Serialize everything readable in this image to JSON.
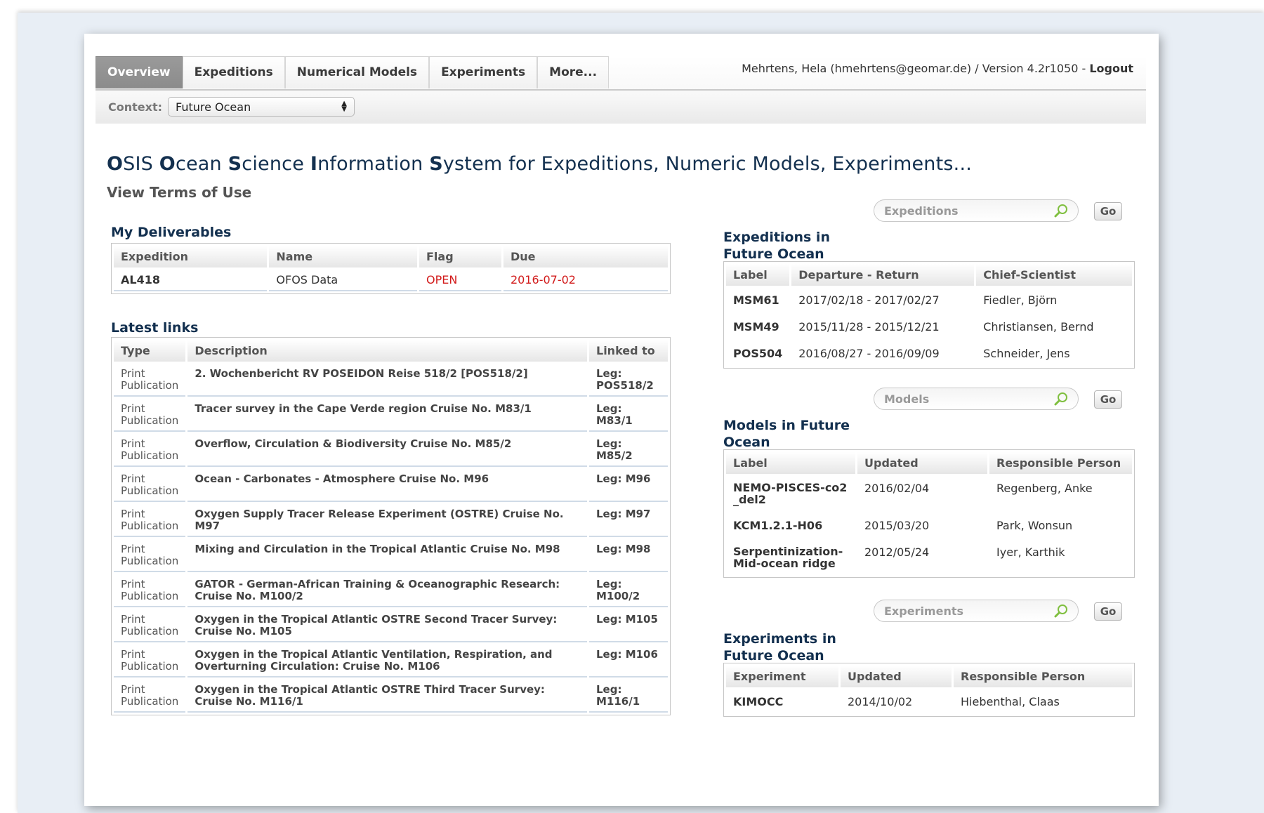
{
  "nav": {
    "tabs": [
      "Overview",
      "Expeditions",
      "Numerical Models",
      "Experiments",
      "More..."
    ],
    "active_tab": "Overview",
    "user": "Mehrtens, Hela (hmehrtens@geomar.de) / Version 4.2r1050 - ",
    "logout": "Logout",
    "context_label": "Context:",
    "context_value": "Future Ocean"
  },
  "title": {
    "parts": [
      "O",
      "SIS ",
      "O",
      "cean ",
      "S",
      "cience ",
      "I",
      "nformation ",
      "S",
      "ystem for Expeditions, Numeric Models, Experiments..."
    ],
    "terms": "View Terms of Use"
  },
  "deliverables": {
    "heading": "My Deliverables",
    "columns": [
      "Expedition",
      "Name",
      "Flag",
      "Due"
    ],
    "rows": [
      {
        "expedition": "AL418",
        "name": "OFOS Data",
        "flag": "OPEN",
        "due": "2016-07-02"
      }
    ]
  },
  "links": {
    "heading": "Latest links",
    "columns": [
      "Type",
      "Description",
      "Linked to"
    ],
    "rows": [
      {
        "type": "Print Publication",
        "desc": "2. Wochenbericht RV POSEIDON Reise 518/2 [POS518/2]",
        "leg": "Leg: POS518/2"
      },
      {
        "type": "Print Publication",
        "desc": "Tracer survey in the Cape Verde region Cruise No. M83/1",
        "leg": "Leg: M83/1"
      },
      {
        "type": "Print Publication",
        "desc": "Overflow, Circulation & Biodiversity Cruise No. M85/2",
        "leg": "Leg: M85/2"
      },
      {
        "type": "Print Publication",
        "desc": "Ocean - Carbonates - Atmosphere Cruise No. M96",
        "leg": "Leg: M96"
      },
      {
        "type": "Print Publication",
        "desc": "Oxygen Supply Tracer Release Experiment (OSTRE) Cruise No. M97",
        "leg": "Leg: M97"
      },
      {
        "type": "Print Publication",
        "desc": "Mixing and Circulation in the Tropical Atlantic Cruise No. M98",
        "leg": "Leg: M98"
      },
      {
        "type": "Print Publication",
        "desc": "GATOR - German-African Training & Oceanographic Research: Cruise No. M100/2",
        "leg": "Leg: M100/2"
      },
      {
        "type": "Print Publication",
        "desc": "Oxygen in the Tropical Atlantic OSTRE Second Tracer Survey: Cruise No. M105",
        "leg": "Leg: M105"
      },
      {
        "type": "Print Publication",
        "desc": "Oxygen in the Tropical Atlantic Ventilation, Respiration, and Overturning Circulation: Cruise No. M106",
        "leg": "Leg: M106"
      },
      {
        "type": "Print Publication",
        "desc": "Oxygen in the Tropical Atlantic OSTRE Third Tracer Survey: Cruise No. M116/1",
        "leg": "Leg: M116/1"
      }
    ]
  },
  "expeditions": {
    "search_placeholder": "Expeditions",
    "go": "Go",
    "heading": "Expeditions in Future Ocean",
    "columns": [
      "Label",
      "Departure - Return",
      "Chief-Scientist"
    ],
    "rows": [
      {
        "label": "MSM61",
        "dates": "2017/02/18 - 2017/02/27",
        "person": "Fiedler, Björn"
      },
      {
        "label": "MSM49",
        "dates": "2015/11/28 - 2015/12/21",
        "person": "Christiansen, Bernd"
      },
      {
        "label": "POS504",
        "dates": "2016/08/27 - 2016/09/09",
        "person": "Schneider, Jens"
      }
    ]
  },
  "models": {
    "search_placeholder": "Models",
    "go": "Go",
    "heading": "Models in Future Ocean",
    "columns": [
      "Label",
      "Updated",
      "Responsible Person"
    ],
    "rows": [
      {
        "label": "NEMO-PISCES-co2_del2",
        "updated": "2016/02/04",
        "person": "Regenberg, Anke"
      },
      {
        "label": "KCM1.2.1-H06",
        "updated": "2015/03/20",
        "person": "Park, Wonsun"
      },
      {
        "label": "Serpentinization-Mid-ocean ridge",
        "updated": "2012/05/24",
        "person": "Iyer, Karthik"
      }
    ]
  },
  "experiments": {
    "search_placeholder": "Experiments",
    "go": "Go",
    "heading": "Experiments in Future Ocean",
    "columns": [
      "Experiment",
      "Updated",
      "Responsible Person"
    ],
    "rows": [
      {
        "label": "KIMOCC",
        "updated": "2014/10/02",
        "person": "Hiebenthal, Claas"
      }
    ]
  },
  "colors": {
    "accent": "#13304f",
    "flag_red": "#d21b1b",
    "active_tab": "#8f8f8f"
  }
}
